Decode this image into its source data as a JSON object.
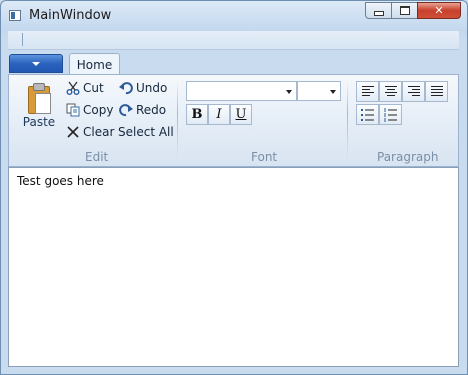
{
  "window": {
    "title": "MainWindow"
  },
  "tabs": [
    {
      "label": "Home"
    }
  ],
  "groups": {
    "edit": {
      "label": "Edit",
      "paste": "Paste",
      "cut": "Cut",
      "copy": "Copy",
      "clear": "Clear",
      "undo": "Undo",
      "redo": "Redo",
      "select_all": "Select All"
    },
    "font": {
      "label": "Font",
      "family_value": "",
      "size_value": "",
      "bold": "B",
      "italic": "I",
      "underline": "U"
    },
    "paragraph": {
      "label": "Paragraph"
    }
  },
  "editor": {
    "text": "Test goes here"
  },
  "icons": [
    "app-icon",
    "minimize-icon",
    "maximize-icon",
    "close-icon",
    "paste-icon",
    "cut-icon",
    "copy-icon",
    "clear-icon",
    "undo-icon",
    "redo-icon",
    "align-left-icon",
    "align-center-icon",
    "align-right-icon",
    "justify-icon",
    "bullets-icon",
    "numbering-icon"
  ],
  "colors": {
    "app_menu": "#2b63be",
    "close": "#c7402b",
    "frame": "#c9dcef"
  }
}
